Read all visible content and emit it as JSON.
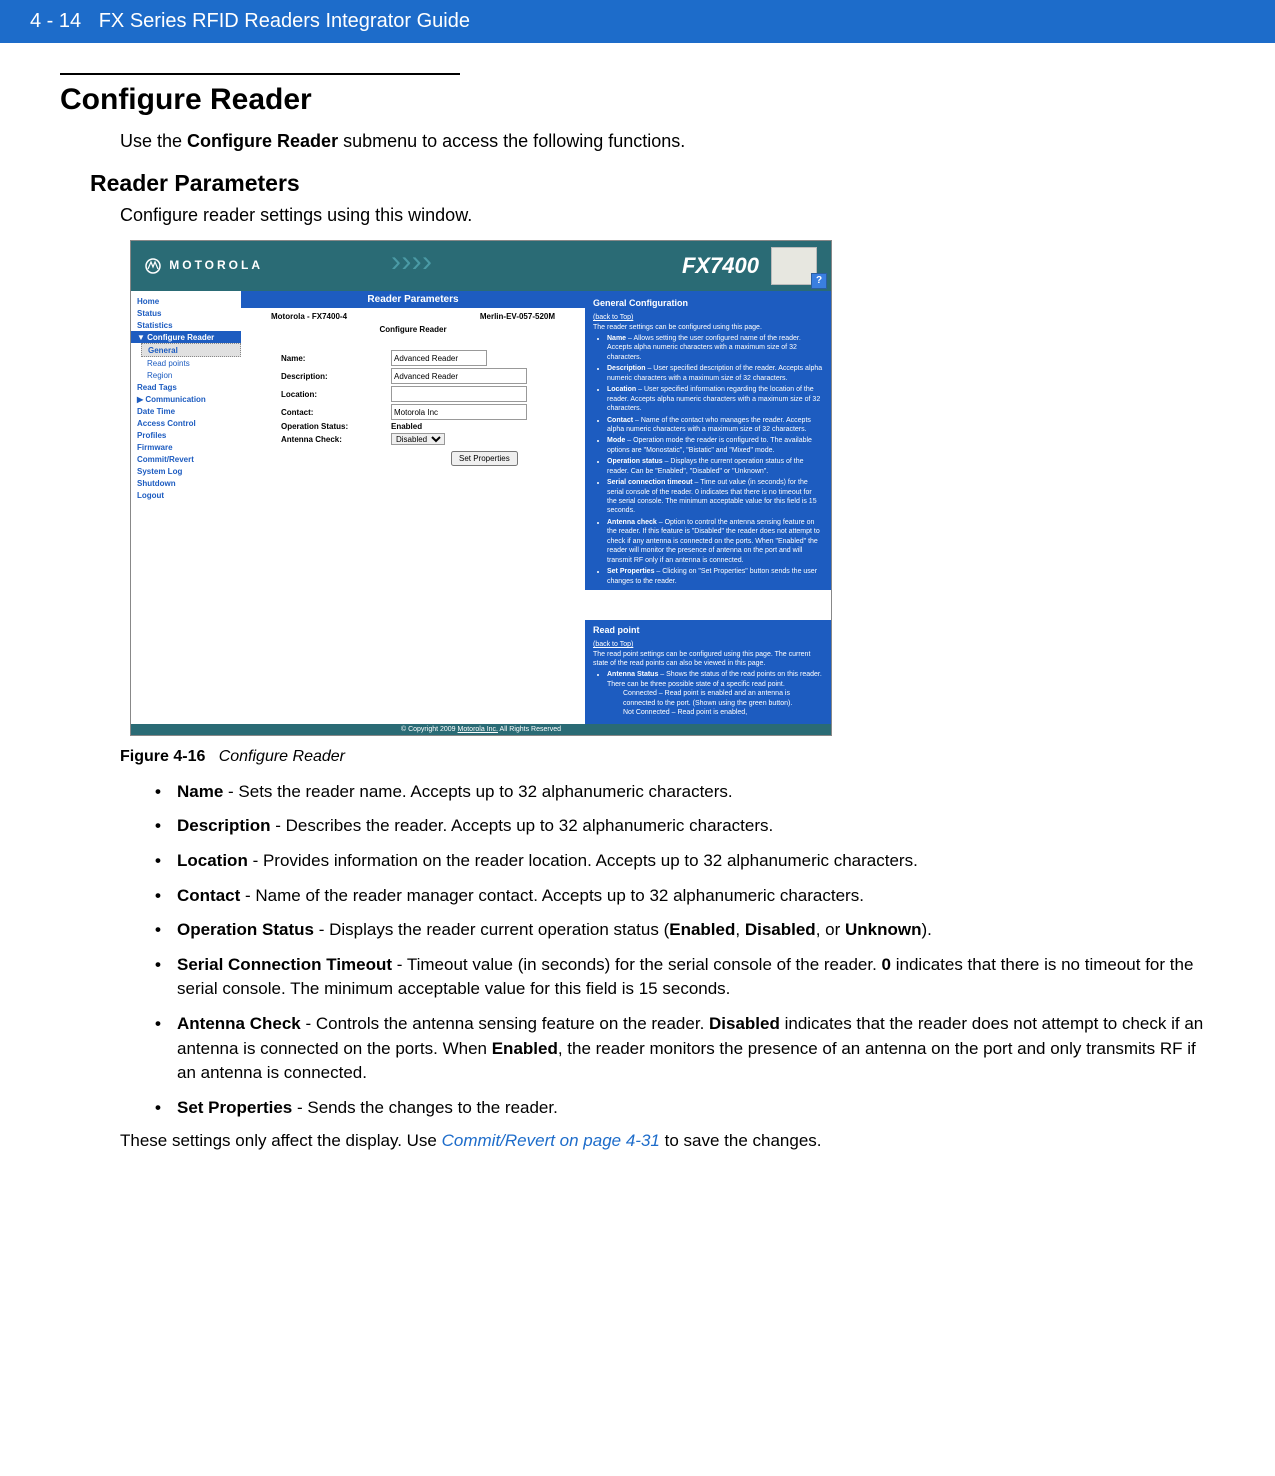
{
  "header": {
    "page": "4 - 14",
    "title": "FX Series RFID Readers Integrator Guide"
  },
  "section": {
    "title": "Configure Reader",
    "intro_pre": "Use the ",
    "intro_bold": "Configure Reader",
    "intro_post": " submenu to access the following functions."
  },
  "subsection": {
    "title": "Reader Parameters",
    "intro": "Configure reader settings using this window."
  },
  "shot": {
    "brand": "MOTOROLA",
    "model": "FX7400",
    "menu": {
      "items": [
        "Home",
        "Status",
        "Statistics"
      ],
      "active": "Configure Reader",
      "sub": "General",
      "in": [
        "Read points",
        "Region"
      ],
      "rest": [
        "Read Tags",
        "Communication",
        "Date Time",
        "Access Control",
        "Profiles",
        "Firmware",
        "Commit/Revert",
        "System Log",
        "Shutdown",
        "Logout"
      ]
    },
    "main": {
      "title": "Reader Parameters",
      "left": "Motorola - FX7400-4",
      "right": "Merlin-EV-057-520M",
      "subtitle": "Configure Reader",
      "fields": {
        "name_label": "Name:",
        "name_value": "Advanced Reader",
        "desc_label": "Description:",
        "desc_value": "Advanced Reader",
        "loc_label": "Location:",
        "loc_value": "",
        "contact_label": "Contact:",
        "contact_value": "Motorola Inc",
        "op_label": "Operation Status:",
        "op_value": "Enabled",
        "ant_label": "Antenna Check:",
        "ant_value": "Disabled"
      },
      "button": "Set Properties"
    },
    "help": {
      "g_title": "General Configuration",
      "back": "(back to Top)",
      "g_intro": "The reader settings can be configured using this page.",
      "g_items": [
        {
          "b": "Name",
          "t": " – Allows setting the user configured name of the reader. Accepts alpha numeric characters with a maximum size of 32 characters."
        },
        {
          "b": "Description",
          "t": " – User specified description of the reader. Accepts alpha numeric characters with a maximum size of 32 characters."
        },
        {
          "b": "Location",
          "t": " – User specified information regarding the location of the reader. Accepts alpha numeric characters with a maximum size of 32 characters."
        },
        {
          "b": "Contact",
          "t": " – Name of the contact who manages the reader. Accepts alpha numeric characters with a maximum size of 32 characters."
        },
        {
          "b": "Mode",
          "t": " – Operation mode the reader is configured to. The available options are \"Monostatic\", \"Bistatic\" and \"Mixed\" mode."
        },
        {
          "b": "Operation status",
          "t": " – Displays the current operation status of the reader. Can be \"Enabled\", \"Disabled\" or \"Unknown\"."
        },
        {
          "b": "Serial connection timeout",
          "t": " – Time out value (in seconds) for the serial console of the reader. 0 indicates that there is no timeout for the serial console. The minimum acceptable value for this field is 15 seconds."
        },
        {
          "b": "Antenna check",
          "t": " – Option to control the antenna sensing feature on the reader. If this feature is \"Disabled\" the reader does not attempt to check if any antenna is connected on the ports. When \"Enabled\" the reader will monitor the presence of antenna on the port and will transmit RF only if an antenna is connected."
        },
        {
          "b": "Set Properties",
          "t": " – Clicking on \"Set Properties\" button sends the user changes to the reader."
        }
      ],
      "r_title": "Read point",
      "r_intro": "The read point settings can be configured using this page. The current state of the read points can also be viewed in this page.",
      "r_item_b": "Antenna Status",
      "r_item_t": " – Shows the status of the read points on this reader. There can be three possible state of a specific read point.",
      "r_sub1": "Connected – Read point is enabled and an antenna is connected to the port. (Shown using the green button).",
      "r_sub2": "Not Connected – Read point is enabled,"
    },
    "footer_pre": "© Copyright 2009 ",
    "footer_link": "Motorola Inc.",
    "footer_post": " All Rights Reserved"
  },
  "figure": {
    "num": "Figure 4-16",
    "caption": "Configure Reader"
  },
  "bullets": [
    {
      "b": "Name",
      "t": " - Sets the reader name. Accepts up to 32 alphanumeric characters."
    },
    {
      "b": "Description",
      "t": " - Describes the reader. Accepts up to 32 alphanumeric characters."
    },
    {
      "b": "Location",
      "t": " - Provides information on the reader location. Accepts up to 32 alphanumeric characters."
    },
    {
      "b": "Contact",
      "t": " - Name of the reader manager contact. Accepts up to 32 alphanumeric characters."
    },
    {
      "b": "Operation Status",
      "t": " - Displays the reader current operation status (",
      "b2": "Enabled",
      "t2": ", ",
      "b3": "Disabled",
      "t3": ", or ",
      "b4": "Unknown",
      "t4": ")."
    },
    {
      "b": "Serial Connection Timeout",
      "t": " - Timeout value (in seconds) for the serial console of the reader. ",
      "b2": "0",
      "t2": " indicates that there is no timeout for the serial console. The minimum acceptable value for this field is 15 seconds."
    },
    {
      "b": "Antenna Check",
      "t": " - Controls the antenna sensing feature on the reader. ",
      "b2": "Disabled",
      "t2": " indicates that the reader does not attempt to check if an antenna is connected on the ports. When ",
      "b3": "Enabled",
      "t3": ", the reader monitors the presence of an antenna on the port and only transmits RF if an antenna is connected."
    },
    {
      "b": "Set Properties",
      "t": " - Sends the changes to the reader."
    }
  ],
  "footnote": {
    "pre": "These settings only affect the display. Use ",
    "link": "Commit/Revert on page 4-31",
    "post": " to save the changes."
  }
}
